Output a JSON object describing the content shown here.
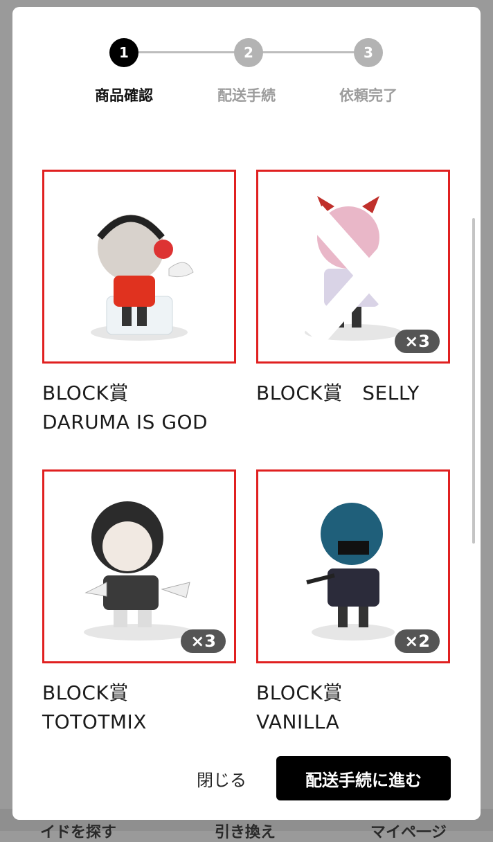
{
  "stepper": {
    "steps": [
      {
        "number": "1",
        "label": "商品確認"
      },
      {
        "number": "2",
        "label": "配送手続"
      },
      {
        "number": "3",
        "label": "依頼完了"
      }
    ]
  },
  "items": [
    {
      "title_line1": "BLOCK賞",
      "title_line2": "DARUMA IS GOD",
      "quantity": ""
    },
    {
      "title_line1": "BLOCK賞　SELLY",
      "title_line2": "",
      "quantity": "×3"
    },
    {
      "title_line1": "BLOCK賞",
      "title_line2": "TOTOTMIX",
      "quantity": "×3"
    },
    {
      "title_line1": "BLOCK賞",
      "title_line2": "VANILLA",
      "quantity": "×2"
    }
  ],
  "footer": {
    "close_label": "閉じる",
    "proceed_label": "配送手続に進む"
  },
  "backdrop": {
    "left_text": "イドを探す",
    "center_text": "引き換え",
    "right_text": "マイペ一ジ"
  },
  "colors": {
    "accent_border": "#e02020",
    "primary_button": "#000000",
    "step_active": "#000000",
    "step_inactive": "#b3b3b3"
  }
}
